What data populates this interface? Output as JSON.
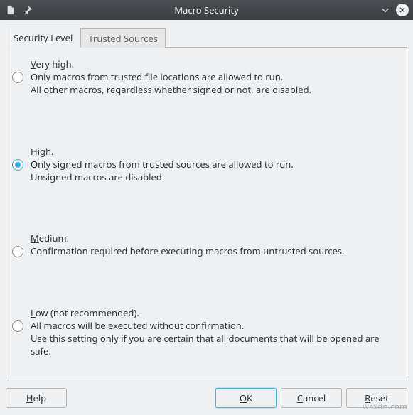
{
  "titlebar": {
    "title": "Macro Security"
  },
  "tabs": [
    {
      "label": "Security Level",
      "active": true
    },
    {
      "label": "Trusted Sources",
      "active": false
    }
  ],
  "options": [
    {
      "id": "very-high",
      "title_pre": "",
      "title_accel": "V",
      "title_post": "ery high.",
      "line2": "Only macros from trusted file locations are allowed to run.",
      "line3": "All other macros, regardless whether signed or not, are disabled.",
      "selected": false
    },
    {
      "id": "high",
      "title_pre": "",
      "title_accel": "H",
      "title_post": "igh.",
      "line2": "Only signed macros from trusted sources are allowed to run.",
      "line3": "Unsigned macros are disabled.",
      "selected": true
    },
    {
      "id": "medium",
      "title_pre": "",
      "title_accel": "M",
      "title_post": "edium.",
      "line2": "Confirmation required before executing macros from untrusted sources.",
      "line3": "",
      "selected": false
    },
    {
      "id": "low",
      "title_pre": "",
      "title_accel": "L",
      "title_post": "ow (not recommended).",
      "line2": "All macros will be executed without confirmation.",
      "line3": "Use this setting only if you are certain that all documents that will be opened are safe.",
      "selected": false
    }
  ],
  "buttons": {
    "help": {
      "pre": "",
      "accel": "H",
      "post": "elp"
    },
    "ok": {
      "pre": "",
      "accel": "O",
      "post": "K"
    },
    "cancel": {
      "pre": "",
      "accel": "C",
      "post": "ancel"
    },
    "reset": {
      "pre": "",
      "accel": "R",
      "post": "eset"
    }
  },
  "watermark": "wsxdn.com"
}
